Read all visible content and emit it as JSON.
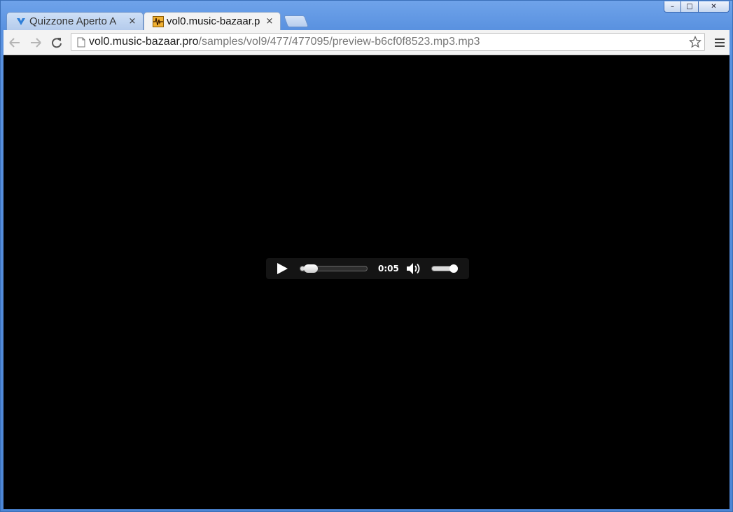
{
  "window": {
    "controls": {
      "minimize": "–",
      "maximize": "□",
      "close": "✕"
    }
  },
  "tabs": [
    {
      "label": "Quizzone Aperto A",
      "icon": "quiz-favicon-icon",
      "close": "×",
      "active": false
    },
    {
      "label": "vol0.music-bazaar.p",
      "icon": "music-file-favicon-icon",
      "close": "×",
      "active": true
    }
  ],
  "toolbar": {
    "url_host": "vol0.music-bazaar.pro",
    "url_path": "/samples/vol9/477/477095/preview-b6cf0f8523.mp3.mp3"
  },
  "player": {
    "time": "0:05",
    "progress_fraction": 0.06,
    "volume_fraction": 1.0
  },
  "colors": {
    "accent": "#4d86d5",
    "content_bg": "#000000"
  }
}
